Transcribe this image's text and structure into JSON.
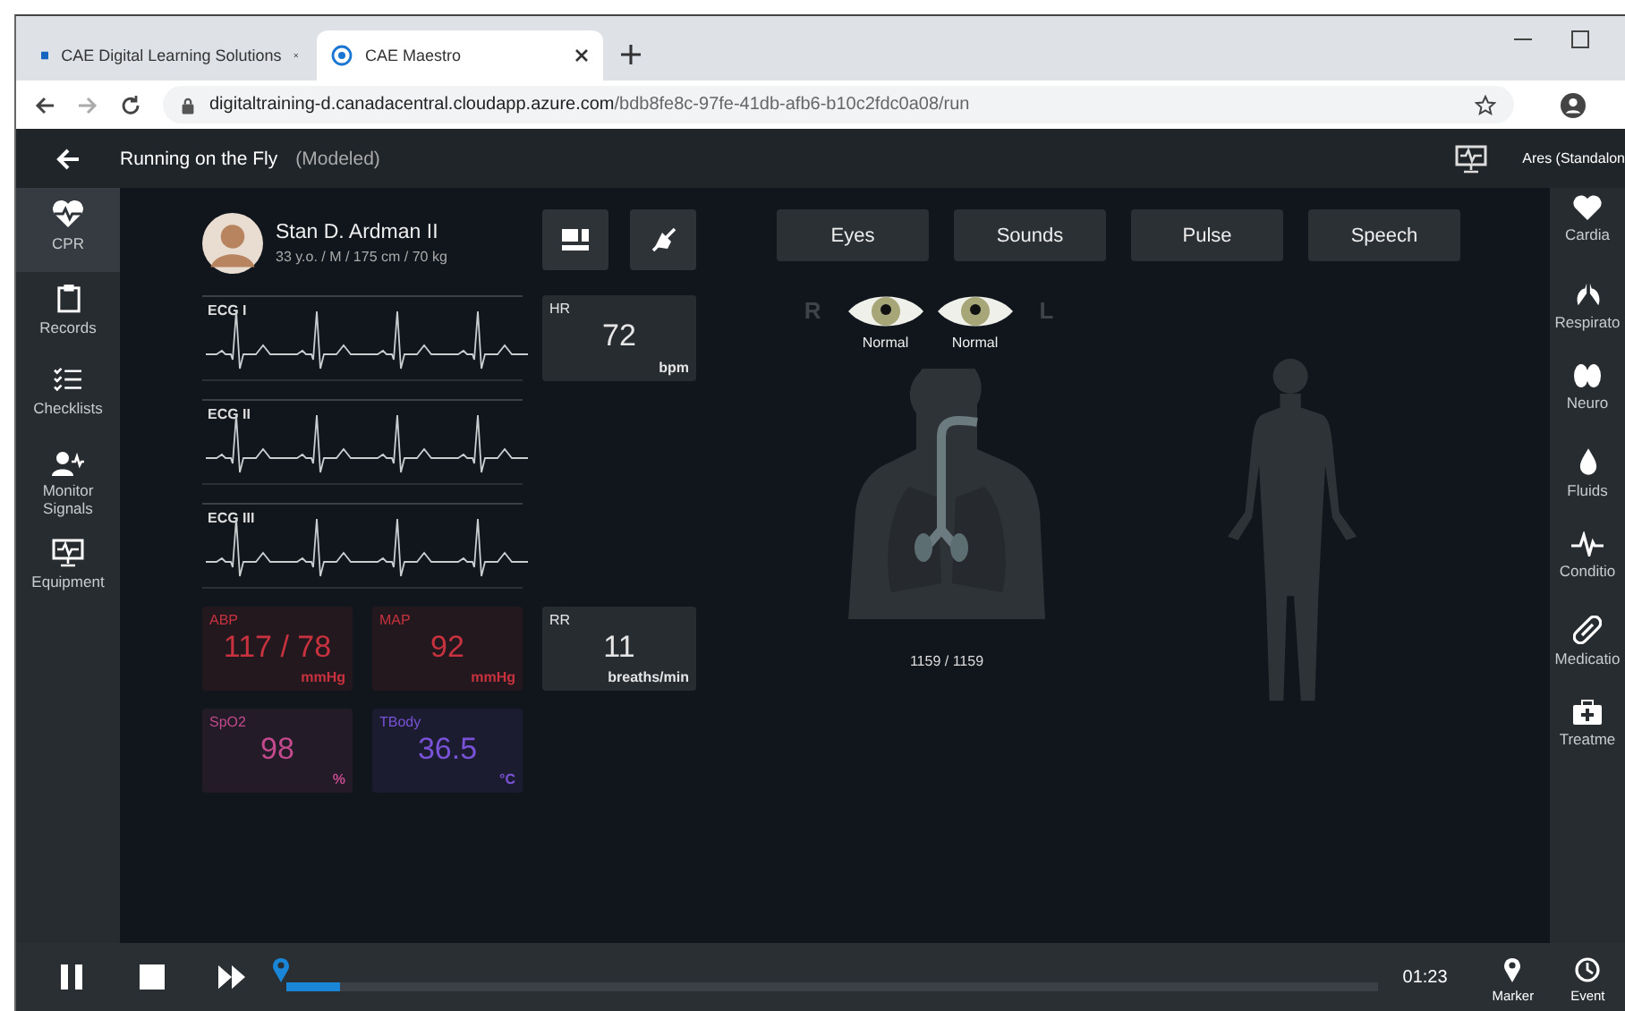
{
  "browser": {
    "tabs": [
      {
        "title": "CAE Digital Learning Solutions",
        "selected": false
      },
      {
        "title": "CAE Maestro",
        "selected": true
      }
    ],
    "url": {
      "host": "digitaltraining-d.canadacentral.cloudapp.azure.com",
      "path": "/bdb8fe8c-97fe-41db-afb6-b10c2fdc0a08/run"
    }
  },
  "header": {
    "title": "Running on the Fly",
    "mode": "(Modeled)",
    "device": "Ares (Standalon"
  },
  "left_nav": [
    {
      "label": "CPR",
      "kind": "cpr",
      "selected": true
    },
    {
      "label": "Records",
      "kind": "records",
      "selected": false
    },
    {
      "label": "Checklists",
      "kind": "checklists",
      "selected": false
    },
    {
      "label": "Monitor Signals",
      "kind": "signals",
      "selected": false
    },
    {
      "label": "Equipment",
      "kind": "equipment",
      "selected": false
    }
  ],
  "patient": {
    "name": "Stan D. Ardman II",
    "details": "33 y.o. / M / 175 cm / 70 kg"
  },
  "ecg": [
    {
      "label": "ECG I"
    },
    {
      "label": "ECG II"
    },
    {
      "label": "ECG III"
    }
  ],
  "vitals": [
    {
      "label": "HR",
      "value": "72",
      "unit": "bpm",
      "color": "#e6e6e6"
    },
    {
      "label": "ABP",
      "value": "117 / 78",
      "unit": "mmHg",
      "color": "#c8323f"
    },
    {
      "label": "MAP",
      "value": "92",
      "unit": "mmHg",
      "color": "#c8323f"
    },
    {
      "label": "RR",
      "value": "11",
      "unit": "breaths/min",
      "color": "#e6e6e6"
    },
    {
      "label": "SpO2",
      "value": "98",
      "unit": "%",
      "color": "#c24a8c"
    },
    {
      "label": "TBody",
      "value": "36.5",
      "unit": "°C",
      "color": "#7a52d8"
    }
  ],
  "exam_buttons": [
    "Eyes",
    "Sounds",
    "Pulse",
    "Speech"
  ],
  "eyes": {
    "right_label": "R",
    "left_label": "L",
    "items": [
      {
        "status": "Normal"
      },
      {
        "status": "Normal"
      }
    ]
  },
  "airway": {
    "reading": "1159 / 1159"
  },
  "right_nav": [
    {
      "label": "Cardia",
      "kind": "cardiac"
    },
    {
      "label": "Respirato",
      "kind": "respiratory"
    },
    {
      "label": "Neuro",
      "kind": "neuro"
    },
    {
      "label": "Fluids",
      "kind": "fluids"
    },
    {
      "label": "Conditio",
      "kind": "conditions"
    },
    {
      "label": "Medicatio",
      "kind": "medications"
    },
    {
      "label": "Treatme",
      "kind": "treatments"
    }
  ],
  "playback": {
    "level": 0.05,
    "time": "01:23",
    "actions": [
      "Marker",
      "Event"
    ]
  }
}
